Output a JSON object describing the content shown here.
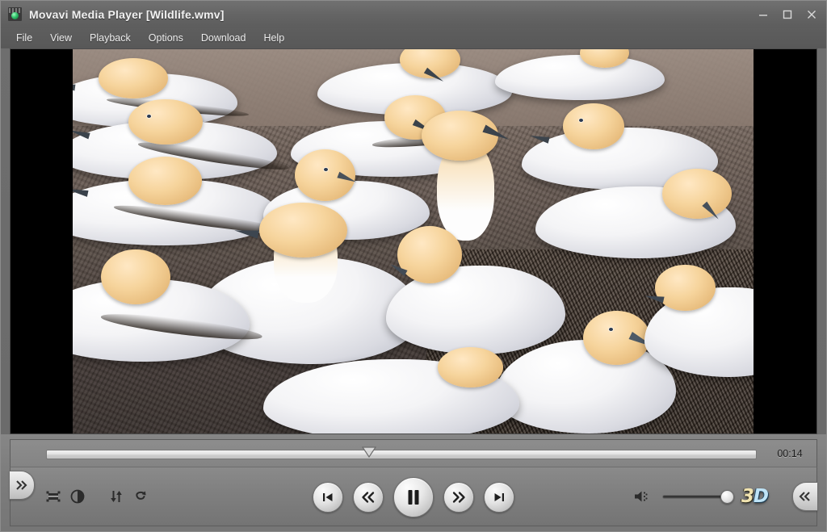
{
  "window": {
    "title": "Movavi Media Player [Wildlife.wmv]",
    "app_icon": "movavi-logo-icon",
    "controls": {
      "minimize": "minimize-icon",
      "maximize": "maximize-icon",
      "close": "close-icon"
    }
  },
  "menubar": {
    "items": [
      {
        "label": "File"
      },
      {
        "label": "View"
      },
      {
        "label": "Playback"
      },
      {
        "label": "Options"
      },
      {
        "label": "Download"
      },
      {
        "label": "Help"
      }
    ]
  },
  "video": {
    "description": "Colony of northern gannets resting on bare ground",
    "letterbox_color": "#000000",
    "aspect": "pillarboxed"
  },
  "seekbar": {
    "position_percent": 45.5,
    "time_label": "00:14",
    "playhead": "seek-playhead-icon"
  },
  "toolbar": {
    "left_tab": "expand-right-icon",
    "right_tab": "collapse-left-icon",
    "tools": [
      {
        "name": "crop-aspect-icon",
        "label": "Crop / Aspect ratio"
      },
      {
        "name": "brightness-contrast-icon",
        "label": "Brightness and contrast"
      },
      {
        "name": "audio-track-icon",
        "label": "Audio track"
      },
      {
        "name": "loop-icon",
        "label": "Repeat"
      }
    ]
  },
  "transport": {
    "buttons": [
      {
        "name": "previous-button",
        "label": "Previous"
      },
      {
        "name": "rewind-button",
        "label": "Rewind"
      },
      {
        "name": "pause-button",
        "label": "Pause"
      },
      {
        "name": "fast-forward-button",
        "label": "Fast forward"
      },
      {
        "name": "next-button",
        "label": "Next"
      }
    ]
  },
  "audio": {
    "speaker_icon": "speaker-icon",
    "volume_percent": 92
  },
  "effects": {
    "logo_three": "3",
    "logo_dee": "D",
    "logo_label": "3D"
  },
  "colors": {
    "chrome": "#767676",
    "titlebar": "#646464",
    "menubar": "#585858",
    "accent_blue": "#bfe4f7",
    "accent_gold": "#f0e3b0",
    "letterbox": "#000000"
  }
}
